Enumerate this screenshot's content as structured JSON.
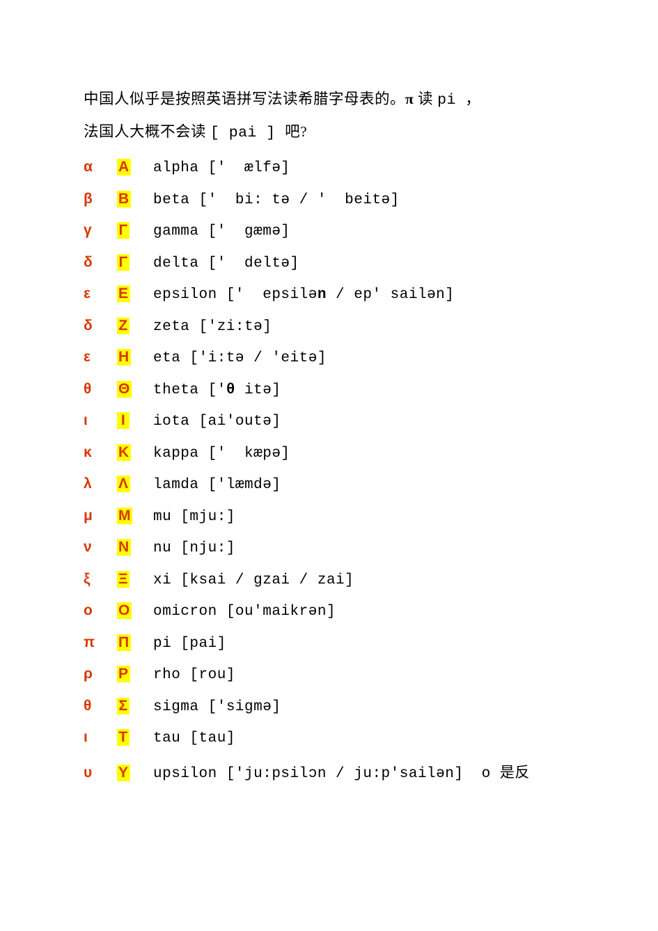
{
  "intro": {
    "prefix": "中国人似乎是按照英语拼写法读希腊字母表的。",
    "pi_symbol": "π",
    "mid": "  读 ",
    "pi_mono": "pi ",
    "trail": "，",
    "line2_prefix": "法国人大概不会读 ",
    "line2_mono": "[ pai ] ",
    "line2_suffix": "吧?"
  },
  "rows": [
    {
      "lc": "α",
      "uc": "Α",
      "segs": [
        {
          "b": false,
          "t": "alpha ['  ælfə]"
        }
      ]
    },
    {
      "lc": "β",
      "uc": "Β",
      "segs": [
        {
          "b": false,
          "t": "beta ['  bi: tə / '  beitə]"
        }
      ]
    },
    {
      "lc": "γ",
      "uc": "Γ",
      "segs": [
        {
          "b": false,
          "t": "gamma ['  gæmə]"
        }
      ]
    },
    {
      "lc": "δ",
      "uc": "Γ",
      "segs": [
        {
          "b": false,
          "t": "delta ['  deltə]"
        }
      ]
    },
    {
      "lc": "ε",
      "uc": "Ε",
      "segs": [
        {
          "b": false,
          "t": "epsilon ['  epsilə"
        },
        {
          "b": true,
          "t": "n"
        },
        {
          "b": false,
          "t": " / ep' sailən]"
        }
      ]
    },
    {
      "lc": "δ",
      "uc": "Ζ",
      "segs": [
        {
          "b": false,
          "t": "zeta ['zi:tə]"
        }
      ]
    },
    {
      "lc": "ε",
      "uc": "Η",
      "segs": [
        {
          "b": false,
          "t": "eta ['i:tə / 'eitə]"
        }
      ]
    },
    {
      "lc": "θ",
      "uc": "Θ",
      "segs": [
        {
          "b": false,
          "t": "theta ['"
        },
        {
          "b": true,
          "t": "θ"
        },
        {
          "b": false,
          "t": " itə]"
        }
      ]
    },
    {
      "lc": "ι",
      "uc": "Ι",
      "segs": [
        {
          "b": false,
          "t": "iota [ai'outə]"
        }
      ]
    },
    {
      "lc": "κ",
      "uc": "Κ",
      "segs": [
        {
          "b": false,
          "t": "kappa ['  kæpə]"
        }
      ]
    },
    {
      "lc": "λ",
      "uc": "Λ",
      "segs": [
        {
          "b": false,
          "t": "lamda ['læmdə]"
        }
      ]
    },
    {
      "lc": "μ",
      "uc": "Μ",
      "segs": [
        {
          "b": false,
          "t": "mu [mju:]"
        }
      ]
    },
    {
      "lc": "ν",
      "uc": "Ν",
      "segs": [
        {
          "b": false,
          "t": "nu [nju:]"
        }
      ]
    },
    {
      "lc": "ξ",
      "uc": "Ξ",
      "segs": [
        {
          "b": false,
          "t": "xi [ksai / gzai / zai]"
        }
      ]
    },
    {
      "lc": "ο",
      "uc": "Ο",
      "segs": [
        {
          "b": false,
          "t": "omicron [ou'maikrən]"
        }
      ]
    },
    {
      "lc": "π",
      "uc": "Π",
      "segs": [
        {
          "b": false,
          "t": "pi [pai]"
        }
      ]
    },
    {
      "lc": "ρ",
      "uc": "Ρ",
      "segs": [
        {
          "b": false,
          "t": "rho [rou]"
        }
      ]
    },
    {
      "lc": "θ",
      "uc": "Σ",
      "segs": [
        {
          "b": false,
          "t": "sigma ['sigmə]"
        }
      ]
    },
    {
      "lc": "ι",
      "uc": "Τ",
      "segs": [
        {
          "b": false,
          "t": "tau [tau]"
        }
      ]
    },
    {
      "lc": "υ",
      "uc": "Υ",
      "segs": [
        {
          "b": false,
          "t": "upsilon ['ju:psilɔn / ju:p'sailən]  o 是反"
        }
      ]
    }
  ]
}
